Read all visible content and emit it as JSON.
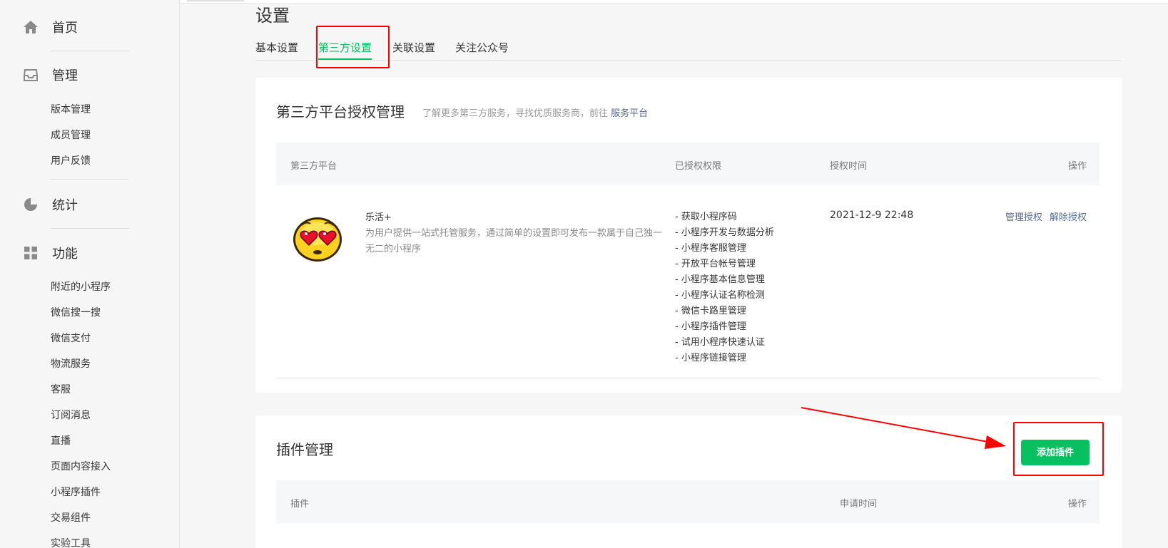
{
  "sidebar": {
    "groups": [
      {
        "label": "首页",
        "icon": "home-icon"
      },
      {
        "label": "管理",
        "icon": "inbox-icon",
        "items": [
          "版本管理",
          "成员管理",
          "用户反馈"
        ]
      },
      {
        "label": "统计",
        "icon": "pie-chart-icon"
      },
      {
        "label": "功能",
        "icon": "grid-icon",
        "items": [
          "附近的小程序",
          "微信搜一搜",
          "微信支付",
          "物流服务",
          "客服",
          "订阅消息",
          "直播",
          "页面内容接入",
          "小程序插件",
          "交易组件",
          "实验工具"
        ]
      }
    ]
  },
  "page": {
    "title": "设置",
    "tabs": [
      "基本设置",
      "第三方设置",
      "关联设置",
      "关注公众号"
    ],
    "active_tab": "第三方设置"
  },
  "third_party": {
    "title": "第三方平台授权管理",
    "desc": "了解更多第三方服务，寻找优质服务商，前往",
    "desc_link": "服务平台",
    "columns": [
      "第三方平台",
      "已授权权限",
      "授权时间",
      "操作"
    ],
    "rows": [
      {
        "name": "乐活+",
        "description": "为用户提供一站式托管服务，通过简单的设置即可发布一款属于自己独一无二的小程序",
        "avatar_icon": "heart-eyes-emoji-icon",
        "permissions": [
          "- 获取小程序码",
          "- 小程序开发与数据分析",
          "- 小程序客服管理",
          "- 开放平台帐号管理",
          "- 小程序基本信息管理",
          "- 小程序认证名称检测",
          "- 微信卡路里管理",
          "- 小程序插件管理",
          "- 试用小程序快速认证",
          "- 小程序链接管理"
        ],
        "auth_time": "2021-12-9 22:48",
        "ops": [
          "管理授权",
          "解除授权"
        ]
      }
    ]
  },
  "plugins": {
    "title": "插件管理",
    "add_button": "添加插件",
    "columns": [
      "插件",
      "申请时间",
      "操作"
    ]
  },
  "colors": {
    "accent": "#07c160",
    "link": "#576b95",
    "annotation": "#ff0000"
  }
}
